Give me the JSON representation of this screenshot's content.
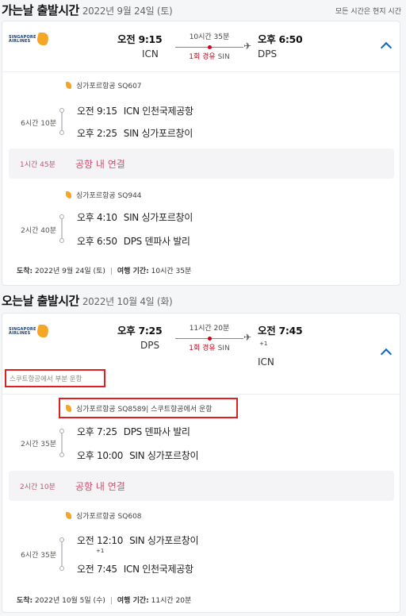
{
  "outbound": {
    "section_title": "가는날 출발시간",
    "section_date": "2022년 9월 24일 (토)",
    "local_time_note": "모든 시간은 현지 시간",
    "summary": {
      "logo_text": "SINGAPORE AIRLINES",
      "dep_time": "오전 9:15",
      "dep_code": "ICN",
      "duration": "10시간 35분",
      "stops": "1회 경유",
      "via": "SIN",
      "arr_time": "오후 6:50",
      "arr_code": "DPS"
    },
    "segments": [
      {
        "airline": "싱가포르항공 SQ607",
        "duration": "6시간 10분",
        "dep": {
          "time": "오전 9:15",
          "airport": "ICN 인천국제공항"
        },
        "arr": {
          "time": "오후 2:25",
          "airport": "SIN 싱가포르창이"
        }
      },
      {
        "airline": "싱가포르항공 SQ944",
        "duration": "2시간 40분",
        "dep": {
          "time": "오후 4:10",
          "airport": "SIN 싱가포르창이"
        },
        "arr": {
          "time": "오후 6:50",
          "airport": "DPS 덴파사 발리"
        }
      }
    ],
    "connection": {
      "duration": "1시간 45분",
      "label": "공항 내 연결"
    },
    "footer": {
      "arrival_label": "도착:",
      "arrival_value": "2022년 9월 24일 (토)",
      "travel_label": "여행 기간:",
      "travel_value": "10시간 35분"
    }
  },
  "inbound": {
    "section_title": "오는날 출발시간",
    "section_date": "2022년 10월 4일 (화)",
    "summary": {
      "logo_text": "SINGAPORE AIRLINES",
      "dep_time": "오후 7:25",
      "dep_code": "DPS",
      "duration": "11시간 20분",
      "stops": "1회 경유",
      "via": "SIN",
      "arr_time": "오전 7:45",
      "arr_plus": "+1",
      "arr_code": "ICN"
    },
    "partial_note": "스쿠트항공에서 부분 운항",
    "segments": [
      {
        "airline": "싱가포르항공 SQ8589| 스쿠트항공에서 운항",
        "duration": "2시간 35분",
        "dep": {
          "time": "오후 7:25",
          "airport": "DPS 덴파사 발리"
        },
        "arr": {
          "time": "오후 10:00",
          "airport": "SIN 싱가포르창이"
        }
      },
      {
        "airline": "싱가포르항공 SQ608",
        "duration": "6시간 35분",
        "dep": {
          "time": "오전 12:10",
          "airport": "SIN 싱가포르창이",
          "plus": "+1"
        },
        "arr": {
          "time": "오전 7:45",
          "airport": "ICN 인천국제공항"
        }
      }
    ],
    "connection": {
      "duration": "2시간 10분",
      "label": "공항 내 연결"
    },
    "footer": {
      "arrival_label": "도착:",
      "arrival_value": "2022년 10월 5일 (수)",
      "travel_label": "여행 기간:",
      "travel_value": "11시간 20분"
    }
  },
  "icons": {
    "plane": "plane-icon",
    "expand": "chevron-up-icon",
    "airline": "singapore-airlines-logo"
  }
}
